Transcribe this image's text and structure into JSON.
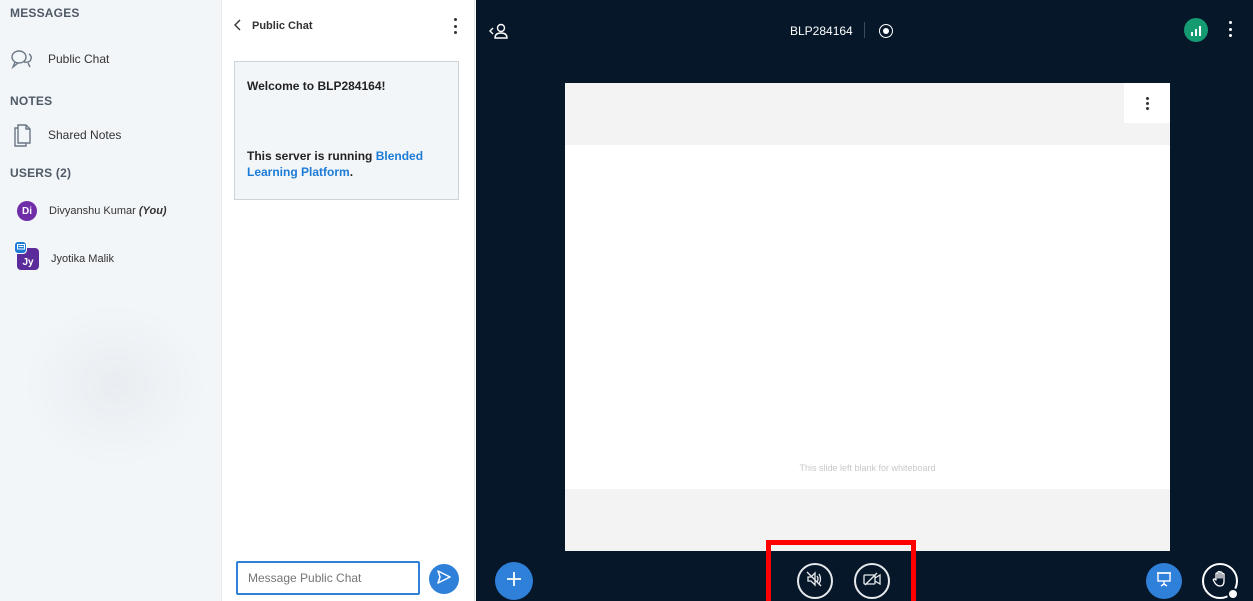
{
  "sidebar": {
    "messages_title": "MESSAGES",
    "public_chat_label": "Public Chat",
    "notes_title": "NOTES",
    "shared_notes_label": "Shared Notes",
    "users_title": "USERS (2)",
    "users": [
      {
        "initials": "Di",
        "name": "Divyanshu Kumar",
        "suffix": "(You)"
      },
      {
        "initials": "Jy",
        "name": "Jyotika Malik",
        "suffix": ""
      }
    ]
  },
  "chat": {
    "title": "Public Chat",
    "welcome_line": "Welcome to BLP284164!",
    "server_prefix": "This server is running ",
    "server_link": "Blended Learning Platform",
    "server_suffix": ".",
    "input_placeholder": "Message Public Chat"
  },
  "main": {
    "meeting_title": "BLP284164",
    "slide_note": "This slide left blank for whiteboard"
  },
  "colors": {
    "accent": "#2f80d8",
    "background_dark": "#06172a",
    "connection": "#159b72",
    "highlight": "#ff0000"
  },
  "icons": [
    "chat-bubbles-icon",
    "notes-icon",
    "users-toggle-icon",
    "record-icon",
    "connection-status-icon",
    "plus-icon",
    "audio-icon",
    "camera-off-icon",
    "presentation-icon",
    "raise-hand-icon",
    "send-icon"
  ]
}
